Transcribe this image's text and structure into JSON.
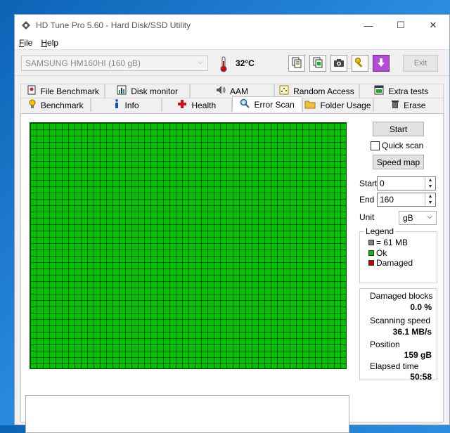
{
  "window": {
    "title": "HD Tune Pro 5.60 - Hard Disk/SSD Utility",
    "minimize": "—",
    "maximize": "☐",
    "close": "✕"
  },
  "menu": [
    {
      "label": "File",
      "access": "F",
      "rest": "ile"
    },
    {
      "label": "Help",
      "access": "H",
      "rest": "elp"
    }
  ],
  "toolbar": {
    "drive": "SAMSUNG HM160HI (160 gB)",
    "temperature": "32°C",
    "exit_label": "Exit"
  },
  "tabs": {
    "row1": [
      "File Benchmark",
      "Disk monitor",
      "AAM",
      "Random Access",
      "Extra tests"
    ],
    "row2": [
      "Benchmark",
      "Info",
      "Health",
      "Error Scan",
      "Folder Usage",
      "Erase"
    ],
    "active": "Error Scan"
  },
  "error_scan": {
    "start_button": "Start",
    "quick_scan_label": "Quick scan",
    "quick_scan_checked": false,
    "speed_map_button": "Speed map",
    "start_label": "Start",
    "start_value": "0",
    "end_label": "End",
    "end_value": "160",
    "unit_label": "Unit",
    "unit_value": "gB",
    "legend": {
      "title": "Legend",
      "block_size": "= 61 MB",
      "ok": "Ok",
      "damaged": "Damaged"
    },
    "stats": {
      "damaged_blocks_label": "Damaged blocks",
      "damaged_blocks_value": "0.0 %",
      "scanning_speed_label": "Scanning speed",
      "scanning_speed_value": "36.1 MB/s",
      "position_label": "Position",
      "position_value": "159 gB",
      "elapsed_time_label": "Elapsed time",
      "elapsed_time_value": "50:58"
    }
  },
  "colors": {
    "ok": "#00c400",
    "damaged": "#c80000",
    "block": "#808080"
  }
}
